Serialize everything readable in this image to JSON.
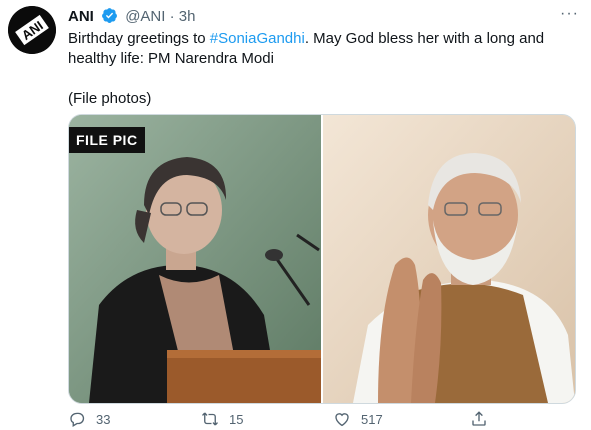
{
  "tweet": {
    "author_name": "ANI",
    "handle": "@ANI",
    "separator": "·",
    "time": "3h",
    "more_menu": "···",
    "text_before": "Birthday greetings to ",
    "hashtag": "#SoniaGandhi",
    "text_after": ". May God bless her with a long and healthy life: PM Narendra Modi",
    "note": "(File photos)",
    "avatar_logo_text": "ANI",
    "media": {
      "left_label": "FILE PIC"
    },
    "actions": {
      "reply_count": "33",
      "retweet_count": "15",
      "like_count": "517"
    }
  },
  "icons": {
    "verified": "verified-badge-icon",
    "reply": "reply-icon",
    "retweet": "retweet-icon",
    "like": "like-icon",
    "share": "share-icon"
  },
  "colors": {
    "accent": "#1d9bf0",
    "muted": "#536471",
    "text": "#0f1419"
  }
}
